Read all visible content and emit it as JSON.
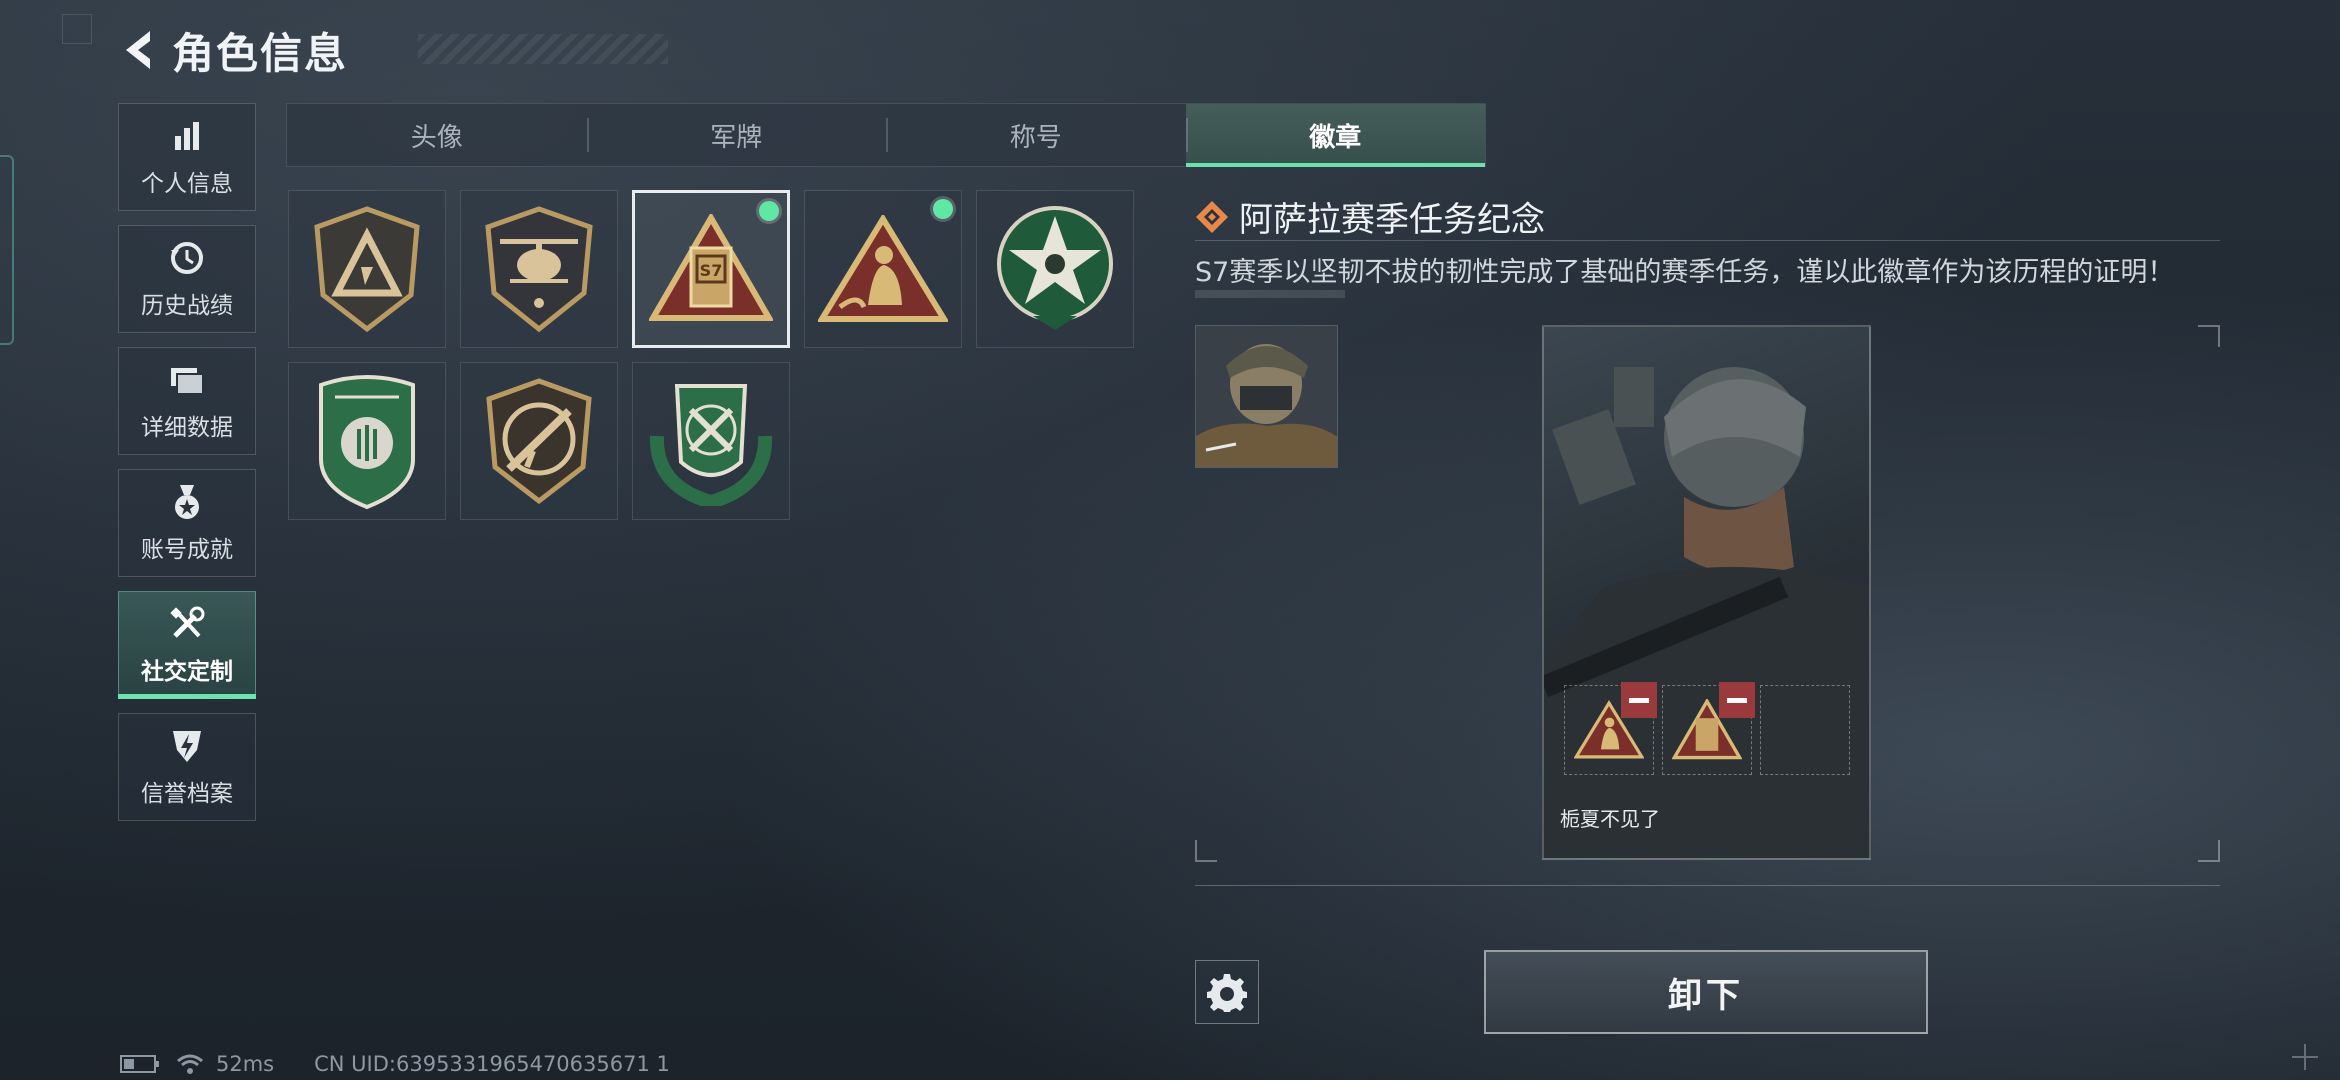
{
  "header": {
    "title": "角色信息"
  },
  "sidebar": {
    "items": [
      {
        "label": "个人信息",
        "icon": "bar-chart-icon"
      },
      {
        "label": "历史战绩",
        "icon": "history-icon"
      },
      {
        "label": "详细数据",
        "icon": "folder-icon"
      },
      {
        "label": "账号成就",
        "icon": "medal-icon"
      },
      {
        "label": "社交定制",
        "icon": "tools-icon",
        "active": true
      },
      {
        "label": "信誉档案",
        "icon": "shield-bolt-icon"
      }
    ]
  },
  "tabs": [
    {
      "label": "头像"
    },
    {
      "label": "军牌"
    },
    {
      "label": "称号"
    },
    {
      "label": "徽章",
      "active": true
    }
  ],
  "badges": [
    {
      "name": "shield-triangle-badge",
      "equipped": false,
      "selected": false
    },
    {
      "name": "helicopter-badge",
      "equipped": false,
      "selected": false
    },
    {
      "name": "s7-badge",
      "equipped": true,
      "selected": true
    },
    {
      "name": "statue-badge",
      "equipped": true,
      "selected": false
    },
    {
      "name": "green-star-badge",
      "equipped": false,
      "selected": false
    },
    {
      "name": "green-shield-badge",
      "equipped": false,
      "selected": false
    },
    {
      "name": "rifle-badge",
      "equipped": false,
      "selected": false
    },
    {
      "name": "green-crossed-badge",
      "equipped": false,
      "selected": false
    }
  ],
  "detail": {
    "title": "阿萨拉赛季任务纪念",
    "description": "S7赛季以坚韧不拔的韧性完成了基础的赛季任务，谨以此徽章作为该历程的证明！",
    "player_name": "栀夏不见了",
    "unequip_label": "卸下"
  },
  "status": {
    "latency": "52ms",
    "uid": "CN UID:6395331965470635671 1"
  },
  "colors": {
    "accent": "#6fe0b0",
    "equipped_dot": "#5fe7a4",
    "remove": "#9b3a3c",
    "gold": "#c9a567"
  }
}
